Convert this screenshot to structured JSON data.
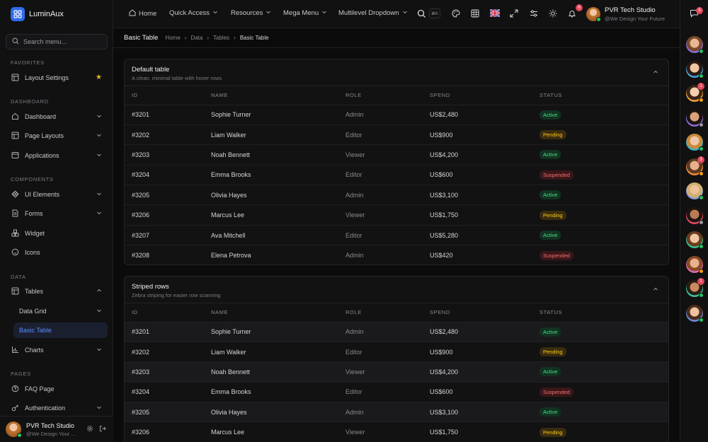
{
  "brand": {
    "name": "LuminAux"
  },
  "search": {
    "placeholder": "Search menu..."
  },
  "sidebar": {
    "sections": [
      {
        "title": "FAVORITES"
      },
      {
        "title": "DASHBOARD"
      },
      {
        "title": "COMPONENTS"
      },
      {
        "title": "DATA"
      },
      {
        "title": "PAGES"
      }
    ],
    "items": [
      {
        "label": "Layout Settings"
      },
      {
        "label": "Dashboard"
      },
      {
        "label": "Page Layouts"
      },
      {
        "label": "Applications"
      },
      {
        "label": "UI Elements"
      },
      {
        "label": "Forms"
      },
      {
        "label": "Widget"
      },
      {
        "label": "Icons"
      },
      {
        "label": "Tables"
      },
      {
        "label": "Data Grid"
      },
      {
        "label": "Basic Table"
      },
      {
        "label": "Charts"
      },
      {
        "label": "FAQ Page"
      },
      {
        "label": "Authentication"
      }
    ],
    "footer": {
      "name": "PVR Tech Studio",
      "subtitle": "@We Design Your ..."
    }
  },
  "topnav": {
    "items": [
      {
        "label": "Home"
      },
      {
        "label": "Quick Access"
      },
      {
        "label": "Resources"
      },
      {
        "label": "Mega Menu"
      },
      {
        "label": "Multilevel Dropdown"
      }
    ],
    "kbd": "⌘K",
    "notifications_count": "6",
    "messages_count": "5",
    "user": {
      "name": "PVR Tech Studio",
      "subtitle": "@We Design Your Future"
    }
  },
  "page": {
    "title": "Basic Table",
    "breadcrumbs": [
      "Home",
      "Data",
      "Tables",
      "Basic Table"
    ]
  },
  "rail": {
    "badges": [
      "1",
      "3",
      "1"
    ]
  },
  "tables": {
    "columns": [
      "ID",
      "NAME",
      "ROLE",
      "SPEND",
      "STATUS"
    ],
    "default": {
      "title": "Default table",
      "subtitle": "A clean, minimal table with hover rows",
      "rows": [
        [
          "#3201",
          "Sophie Turner",
          "Admin",
          "US$2,480",
          "Active"
        ],
        [
          "#3202",
          "Liam Walker",
          "Editor",
          "US$900",
          "Pending"
        ],
        [
          "#3203",
          "Noah Bennett",
          "Viewer",
          "US$4,200",
          "Active"
        ],
        [
          "#3204",
          "Emma Brooks",
          "Editor",
          "US$600",
          "Suspended"
        ],
        [
          "#3205",
          "Olivia Hayes",
          "Admin",
          "US$3,100",
          "Active"
        ],
        [
          "#3206",
          "Marcus Lee",
          "Viewer",
          "US$1,750",
          "Pending"
        ],
        [
          "#3207",
          "Ava Mitchell",
          "Editor",
          "US$5,280",
          "Active"
        ],
        [
          "#3208",
          "Elena Petrova",
          "Admin",
          "US$420",
          "Suspended"
        ]
      ]
    },
    "striped": {
      "title": "Striped rows",
      "subtitle": "Zebra striping for easier row scanning",
      "rows": [
        [
          "#3201",
          "Sophie Turner",
          "Admin",
          "US$2,480",
          "Active"
        ],
        [
          "#3202",
          "Liam Walker",
          "Editor",
          "US$900",
          "Pending"
        ],
        [
          "#3203",
          "Noah Bennett",
          "Viewer",
          "US$4,200",
          "Active"
        ],
        [
          "#3204",
          "Emma Brooks",
          "Editor",
          "US$600",
          "Suspended"
        ],
        [
          "#3205",
          "Olivia Hayes",
          "Admin",
          "US$3,100",
          "Active"
        ],
        [
          "#3206",
          "Marcus Lee",
          "Viewer",
          "US$1,750",
          "Pending"
        ]
      ]
    }
  },
  "colors": {
    "accent": "#2f6bf0",
    "active": "#4ade80",
    "pending": "#facc15",
    "suspended": "#f87171",
    "online": "#22c55e",
    "away": "#f59e0b"
  }
}
